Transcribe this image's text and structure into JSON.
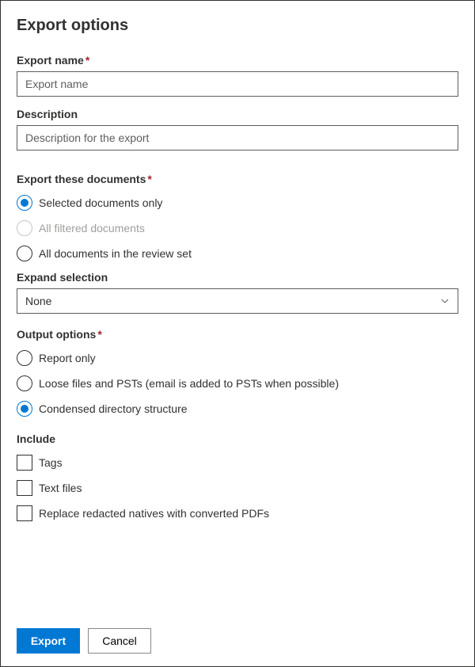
{
  "title": "Export options",
  "exportName": {
    "label": "Export name",
    "placeholder": "Export name",
    "required": "*"
  },
  "description": {
    "label": "Description",
    "placeholder": "Description for the export"
  },
  "documentsSection": {
    "label": "Export these documents",
    "required": "*",
    "options": {
      "selected": "Selected documents only",
      "filtered": "All filtered documents",
      "all": "All documents in the review set"
    }
  },
  "expand": {
    "label": "Expand selection",
    "value": "None"
  },
  "outputSection": {
    "label": "Output options",
    "required": "*",
    "options": {
      "report": "Report only",
      "loose": "Loose files and PSTs (email is added to PSTs when possible)",
      "condensed": "Condensed directory structure"
    }
  },
  "includeSection": {
    "label": "Include",
    "options": {
      "tags": "Tags",
      "textFiles": "Text files",
      "replace": "Replace redacted natives with converted PDFs"
    }
  },
  "buttons": {
    "export": "Export",
    "cancel": "Cancel"
  }
}
